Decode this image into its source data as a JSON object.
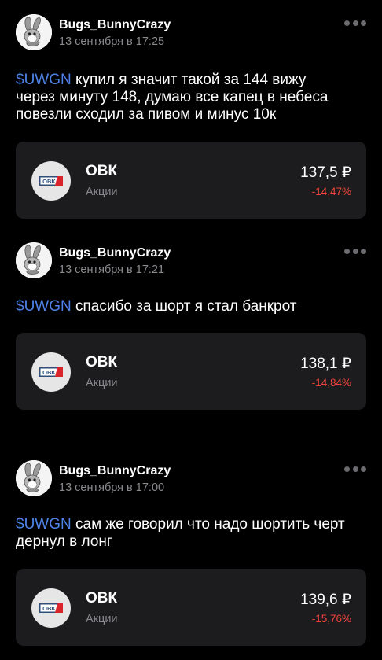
{
  "theme": {
    "background": "#000000",
    "card_background": "#1c1c1e",
    "ticker_color": "#4f82e8",
    "negative_color": "#f04438",
    "muted_text": "#8a8a8e"
  },
  "posts": [
    {
      "author": "Bugs_BunnyCrazy",
      "date": "13 сентября в 17:25",
      "avatar_icon": "bugs-bunny-avatar",
      "ticker": "$UWGN",
      "text_line1": " купил  я значит такой за 144 вижу",
      "text_line2": "через минуту 148, думаю все капец в небеса",
      "text_line3": "повезли сходил за пивом и минус 10к",
      "instrument": {
        "logo_icon": "ovk-logo",
        "logo_text": "OBK",
        "name": "ОВК",
        "type": "Акции",
        "price": "137,5 ₽",
        "change": "-14,47%"
      }
    },
    {
      "author": "Bugs_BunnyCrazy",
      "date": "13 сентября в 17:21",
      "avatar_icon": "bugs-bunny-avatar",
      "ticker": "$UWGN",
      "text_line1": " спасибо за шорт я стал банкрот",
      "instrument": {
        "logo_icon": "ovk-logo",
        "logo_text": "OBK",
        "name": "ОВК",
        "type": "Акции",
        "price": "138,1 ₽",
        "change": "-14,84%"
      }
    },
    {
      "author": "Bugs_BunnyCrazy",
      "date": "13 сентября в 17:00",
      "avatar_icon": "bugs-bunny-avatar",
      "ticker": "$UWGN",
      "text_line1": " сам же говорил что надо шортить черт",
      "text_line2": "дернул в лонг",
      "instrument": {
        "logo_icon": "ovk-logo",
        "logo_text": "OBK",
        "name": "ОВК",
        "type": "Акции",
        "price": "139,6 ₽",
        "change": "-15,76%"
      }
    }
  ]
}
